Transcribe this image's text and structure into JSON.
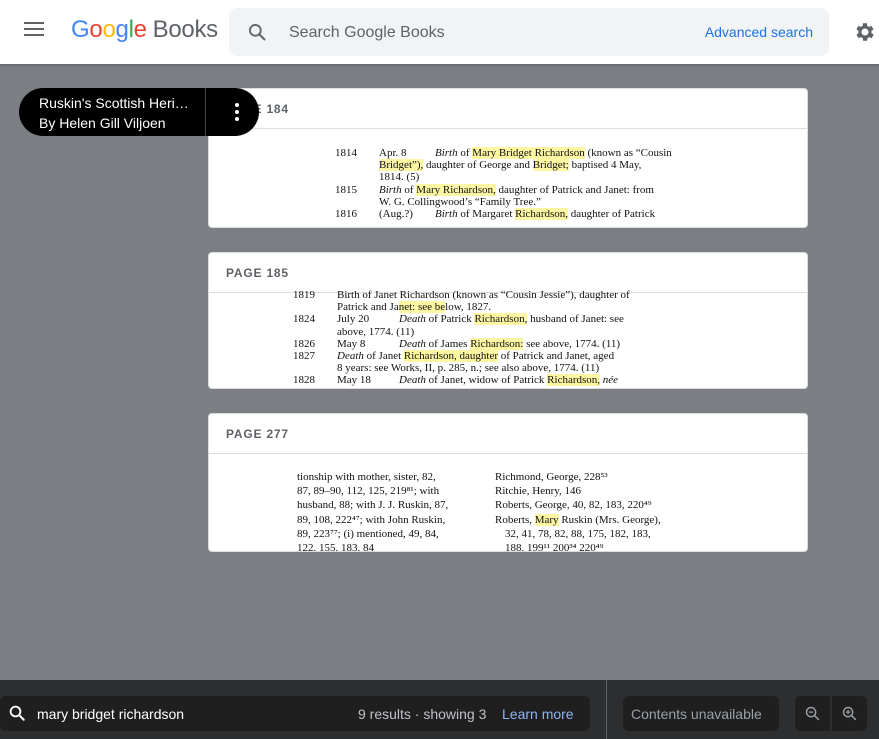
{
  "header": {
    "logo_google": "Google",
    "logo_books": "Books",
    "search_placeholder": "Search Google Books",
    "advanced_search": "Advanced search"
  },
  "book": {
    "title": "Ruskin's Scottish Heritage: A Prelude",
    "author": "By Helen Gill Viljoen"
  },
  "pages": [
    {
      "label": "PAGE 184",
      "label_visible": "184",
      "lines": [
        {
          "a": "1814",
          "b": "Apr. 8",
          "c1": "Birth",
          "c2": "of",
          "h1": "Mary Bridget Richardson",
          "c3": "(known as “Cousin"
        },
        {
          "h2": "Bridget”),",
          "d1": "daughter of George and",
          "h3": "Bridget;",
          "d2": "baptised 4 May,"
        },
        {
          "e": "1814. (5)"
        },
        {
          "a": "1815",
          "f1": "Birth",
          "f2": "of",
          "h4": "Mary Richardson,",
          "f3": "daughter of Patrick and Janet: from"
        },
        {
          "g": "W. G. Collingwood’s “Family Tree.”"
        },
        {
          "a": "1816",
          "b": "(Aug.?)",
          "i1": "Birth",
          "i2": "of Margaret",
          "h5": "Richardson,",
          "i3": "daughter of Patrick"
        }
      ]
    },
    {
      "label": "PAGE 185",
      "lines": [
        {
          "a": "1819",
          "t": "Birth of Janet Richardson (known as “Cousin Jessie”), daughter of"
        },
        {
          "t1": "Patrick and Ja",
          "h": "net: see be",
          "t2": "low, 1827."
        },
        {
          "a": "1824",
          "b": "July 20",
          "c": "Death",
          "d": "of Patrick",
          "h": "Richardson,",
          "e": "husband of Janet: see"
        },
        {
          "t": "above, 1774. (11)"
        },
        {
          "a": "1826",
          "b": "May 8",
          "c": "Death",
          "d": "of James",
          "h": "Richardson:",
          "e": "see above, 1774. (11)"
        },
        {
          "a": "1827",
          "c": "Death",
          "d": "of Janet",
          "h": "Richardson, daughter",
          "e": "of Patrick and Janet, aged"
        },
        {
          "t": "8 years: see Works, II, p. 285, n.; see also above, 1774. (11)"
        },
        {
          "a": "1828",
          "b": "May 18",
          "c": "Death",
          "d": "of Janet, widow of Patrick",
          "h": "Richardson,",
          "e": "née"
        }
      ]
    },
    {
      "label": "PAGE 277",
      "left": [
        "tionship with mother, sister, 82,",
        "87, 89–90, 112, 125, 219⁸¹; with",
        "husband, 88; with J. J. Ruskin, 87,",
        "89, 108, 222⁴⁷; with John Ruskin,",
        "89, 223⁷⁷; (i) mentioned, 49, 84,",
        "122, 155, 183, 84"
      ],
      "right": [
        "Richmond, George, 228⁵³",
        "Ritchie, Henry, 146",
        "Roberts, George, 40, 82, 183, 220⁴⁹",
        "Roberts,",
        "Mary",
        "Ruskin (Mrs. George),",
        "32, 41, 78, 82, 88, 175, 182, 183,",
        "188, 199¹¹ 200³⁴ 220⁴⁹"
      ]
    }
  ],
  "find": {
    "query": "mary bridget richardson",
    "count": "9 results · showing 3",
    "learn_more": "Learn more"
  },
  "contents": "Contents unavailable",
  "colors": {
    "accent": "#1a73e8",
    "highlight": "#fdf6a3",
    "viewer_bg": "#7b7f84",
    "bottom_bar": "#2d2e30"
  },
  "icons": [
    "menu-icon",
    "search-icon",
    "gear-icon",
    "more-vert-icon",
    "zoom-out-icon",
    "zoom-in-icon"
  ]
}
